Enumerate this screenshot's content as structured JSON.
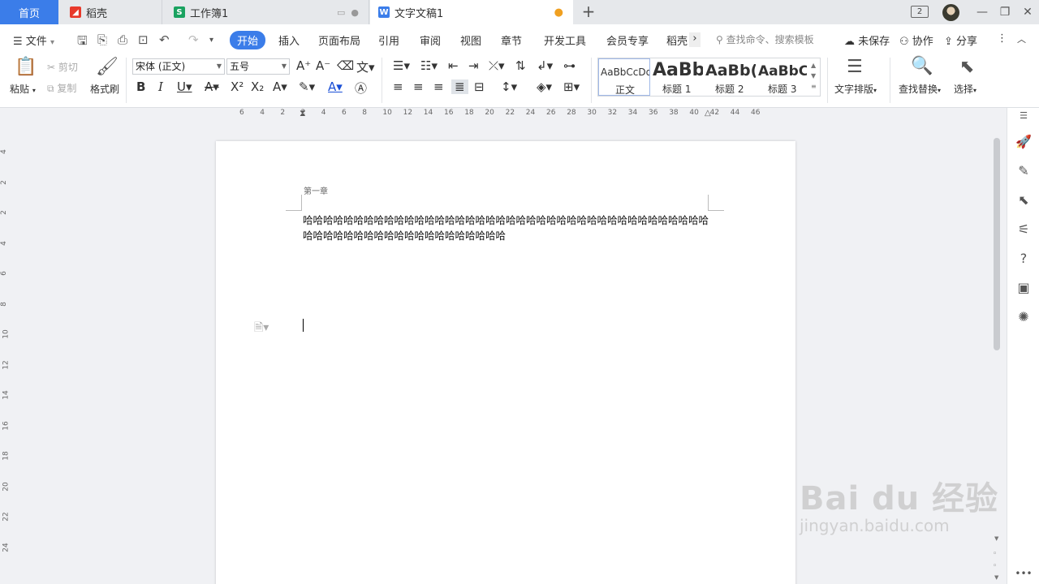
{
  "tabs": {
    "home": "首页",
    "daoke": "稻壳",
    "workbook": "工作簿1",
    "doc": "文字文稿1"
  },
  "titlebar": {
    "badge": "2"
  },
  "menu": {
    "file": "文件",
    "items": [
      "开始",
      "插入",
      "页面布局",
      "引用",
      "审阅",
      "视图",
      "章节",
      "开发工具",
      "会员专享",
      "稻壳"
    ],
    "search": "查找命令、搜索模板",
    "unsaved": "未保存",
    "collab": "协作",
    "share": "分享"
  },
  "ribbon": {
    "paste": "粘贴",
    "cut": "剪切",
    "copy": "复制",
    "format_painter": "格式刷",
    "font_name": "宋体 (正文)",
    "font_size": "五号",
    "styles": [
      {
        "preview": "AaBbCcDd",
        "label": "正文"
      },
      {
        "preview": "AaBb",
        "label": "标题 1"
      },
      {
        "preview": "AaBb(",
        "label": "标题 2"
      },
      {
        "preview": "AaBbC(",
        "label": "标题 3"
      }
    ],
    "text_layout": "文字排版",
    "find_replace": "查找替换",
    "select": "选择"
  },
  "ruler": {
    "h_ticks": [
      "6",
      "4",
      "2",
      "2",
      "4",
      "6",
      "8",
      "10",
      "12",
      "14",
      "16",
      "18",
      "20",
      "22",
      "24",
      "26",
      "28",
      "30",
      "32",
      "34",
      "36",
      "38",
      "40",
      "42",
      "44",
      "46"
    ],
    "v_ticks": [
      "4",
      "2",
      "2",
      "4",
      "6",
      "8",
      "10",
      "12",
      "14",
      "16",
      "18",
      "20",
      "22",
      "24"
    ]
  },
  "document": {
    "header": "第一章",
    "body": "哈哈哈哈哈哈哈哈哈哈哈哈哈哈哈哈哈哈哈哈哈哈哈哈哈哈哈哈哈哈哈哈哈哈哈哈哈哈哈哈哈哈哈哈哈哈哈哈哈哈哈哈哈哈哈哈哈哈哈哈"
  },
  "watermark": {
    "top": "Bai du 经验",
    "bottom": "jingyan.baidu.com"
  }
}
